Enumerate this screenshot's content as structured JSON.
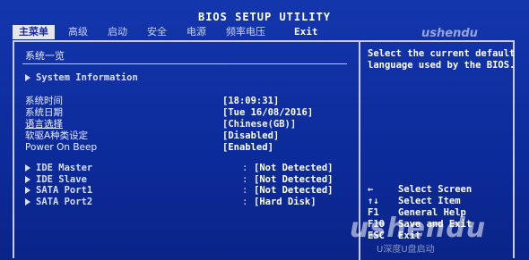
{
  "title": "BIOS SETUP UTILITY",
  "menu": {
    "tabs": [
      {
        "label": "主菜单"
      },
      {
        "label": "高级"
      },
      {
        "label": "启动"
      },
      {
        "label": "安全"
      },
      {
        "label": "电源"
      },
      {
        "label": "频率电压"
      },
      {
        "label": "Exit"
      }
    ]
  },
  "main": {
    "section_title": "系统一览",
    "system_information": "System Information",
    "rows": [
      {
        "label": "系统时间",
        "value": "[18:09:31]"
      },
      {
        "label": "系统日期",
        "value": "[Tue 16/08/2016]"
      },
      {
        "label": "语言选择",
        "value": "[Chinese(GB)]"
      },
      {
        "label": "软驱A种类设定",
        "value": "[Disabled]"
      },
      {
        "label": "Power On Beep",
        "value": "[Enabled]"
      }
    ],
    "ports": [
      {
        "label": "IDE Master",
        "value": "[Not Detected]"
      },
      {
        "label": "IDE Slave",
        "value": "[Not Detected]"
      },
      {
        "label": "SATA Port1",
        "value": "[Not Detected]"
      },
      {
        "label": "SATA Port2",
        "value": "[Hard Disk]"
      }
    ]
  },
  "help": {
    "text": "Select the current default language used by the BIOS."
  },
  "keys": [
    {
      "key": "←",
      "desc": "Select Screen"
    },
    {
      "key": "↑↓",
      "desc": "Select Item"
    },
    {
      "key": "F1",
      "desc": "General Help"
    },
    {
      "key": "F10",
      "desc": "Save and Exit"
    },
    {
      "key": "ESC",
      "desc": "Exit"
    }
  ],
  "watermark": {
    "brand": "ushendu",
    "tagline": "U深度U盘启动"
  },
  "colors": {
    "background": "#0d2f9e",
    "frame": "#c7cde8",
    "active_tab_bg": "#e6e6e6",
    "text": "#ffffff"
  }
}
